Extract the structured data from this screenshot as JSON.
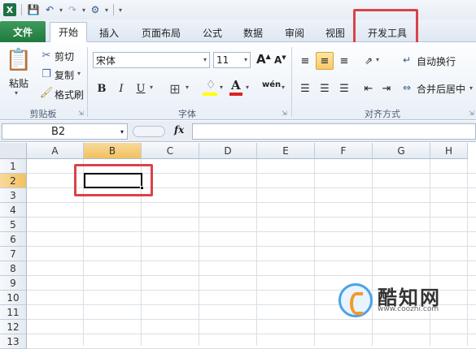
{
  "qat": {
    "app_icon": "X",
    "save_icon": "save-icon",
    "undo_icon": "undo-icon",
    "redo_icon": "redo-icon",
    "custom_icon": "tools-icon"
  },
  "tabs": {
    "file": "文件",
    "items": [
      "开始",
      "插入",
      "页面布局",
      "公式",
      "数据",
      "审阅",
      "视图",
      "开发工具"
    ],
    "active": "开始",
    "highlighted": "开发工具"
  },
  "ribbon": {
    "clipboard": {
      "paste": "粘贴",
      "cut": "剪切",
      "copy": "复制",
      "format_painter": "格式刷",
      "label": "剪贴板"
    },
    "font": {
      "family": "宋体",
      "size": "11",
      "grow": "A",
      "shrink": "A",
      "bold": "B",
      "italic": "I",
      "underline": "U",
      "wen": "wén",
      "label": "字体",
      "font_color": "A",
      "font_color_hex": "#e02020",
      "fill_color_hex": "#ffff00"
    },
    "alignment": {
      "wrap": "自动换行",
      "merge": "合并后居中",
      "label": "对齐方式"
    }
  },
  "formula_bar": {
    "name_box": "B2",
    "fx": "fx",
    "formula": ""
  },
  "grid": {
    "columns": [
      "A",
      "B",
      "C",
      "D",
      "E",
      "F",
      "G",
      "H"
    ],
    "rows": [
      "1",
      "2",
      "3",
      "4",
      "5",
      "6",
      "7",
      "8",
      "9",
      "10",
      "11",
      "12",
      "13"
    ],
    "selected_cell": "B2",
    "selected_column": "B",
    "selected_row": "2"
  },
  "watermark": {
    "name": "酷知网",
    "url": "www.coozhi.com"
  },
  "colors": {
    "highlight_box": "#d9434a",
    "file_tab": "#1f7a3e",
    "selection_header": "#f1c15f"
  }
}
